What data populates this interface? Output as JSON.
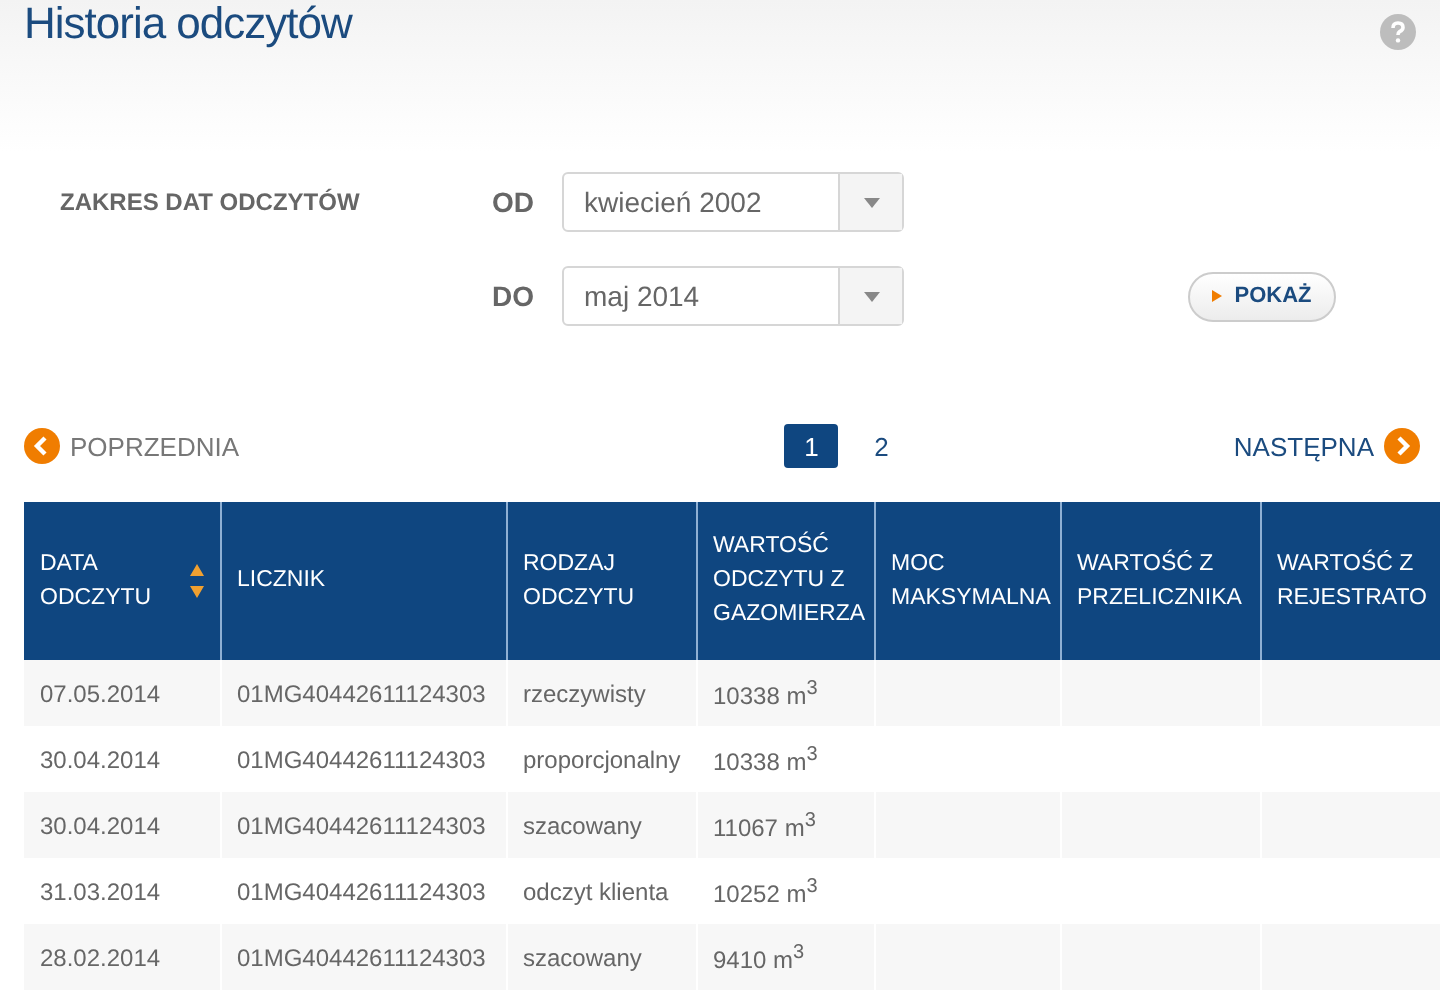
{
  "title": "Historia odczytów",
  "filter": {
    "label": "ZAKRES DAT ODCZYTÓW",
    "from_label": "OD",
    "from_value": "kwiecień 2002",
    "to_label": "DO",
    "to_value": "maj 2014",
    "button": "POKAŻ"
  },
  "pagination": {
    "previous": "POPRZEDNIA",
    "next": "NASTĘPNA",
    "pages": [
      {
        "label": "1",
        "selected": true
      },
      {
        "label": "2",
        "selected": false
      }
    ]
  },
  "table": {
    "columns": [
      {
        "label": "DATA ODCZYTU",
        "sortable": true
      },
      {
        "label": "LICZNIK",
        "sortable": false
      },
      {
        "label": "RODZAJ ODCZYTU",
        "sortable": false
      },
      {
        "label": "WARTOŚĆ ODCZYTU Z GAZOMIERZA",
        "sortable": false
      },
      {
        "label": "MOC MAKSYMALNA",
        "sortable": false
      },
      {
        "label": "WARTOŚĆ Z PRZELICZNIKA",
        "sortable": false
      },
      {
        "label": "WARTOŚĆ Z REJESTRATO",
        "sortable": false
      }
    ],
    "rows": [
      [
        "07.05.2014",
        "01MG40442611124303",
        "rzeczywisty",
        "10338 m$^{3}$"
      ],
      [
        "30.04.2014",
        "01MG40442611124303",
        "proporcjonalny",
        "10338 m$^{3}$"
      ],
      [
        "30.04.2014",
        "01MG40442611124303",
        "szacowany",
        "11067 m$^{3}$"
      ],
      [
        "31.03.2014",
        "01MG40442611124303",
        "odczyt klienta",
        "10252 m$^{3}$"
      ],
      [
        "28.02.2014",
        "01MG40442611124303",
        "szacowany",
        "9410 m$^{3}$"
      ]
    ]
  }
}
